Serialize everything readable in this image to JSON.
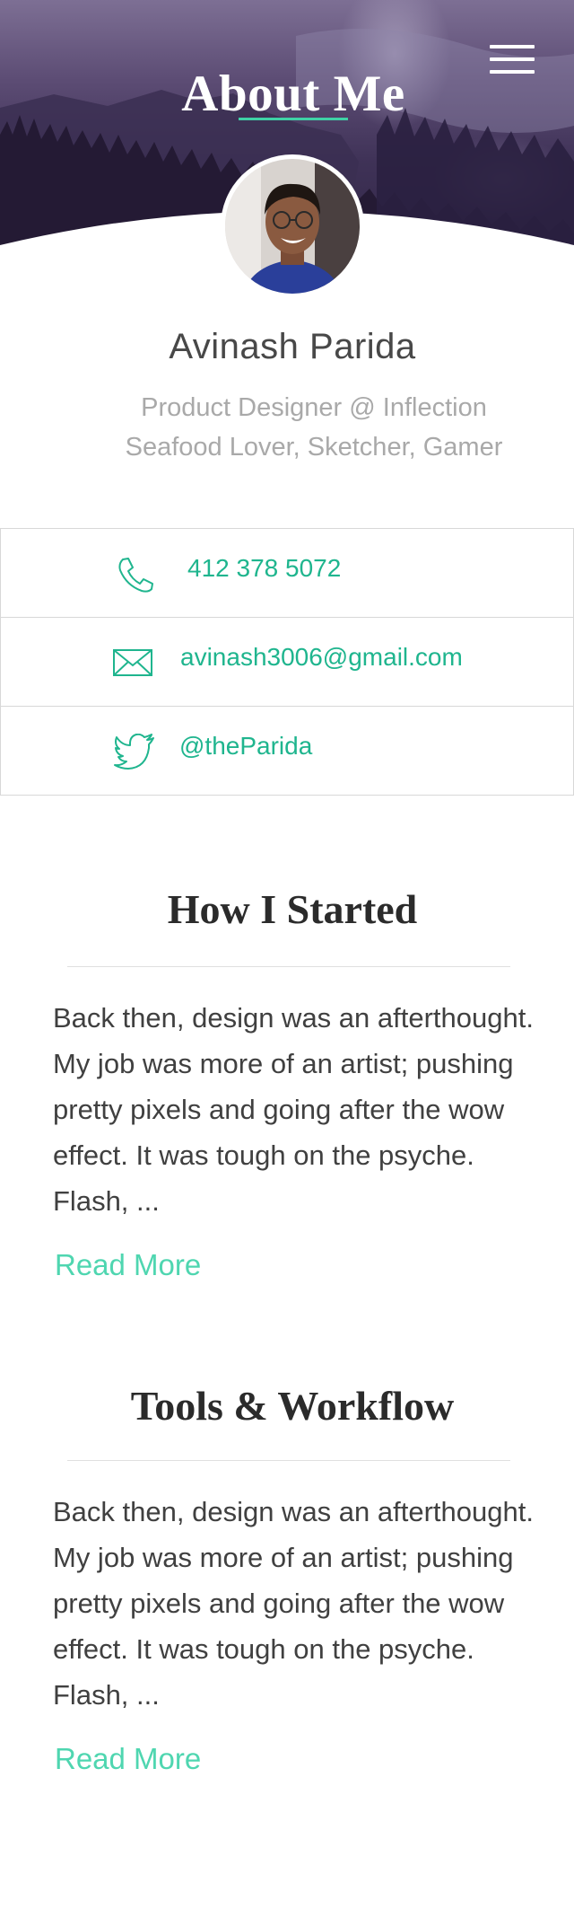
{
  "header": {
    "title": "About Me",
    "menu_icon": "hamburger-menu-icon",
    "accent_color": "#3fd1a6"
  },
  "profile": {
    "avatar_icon": "profile-photo",
    "name": "Avinash Parida",
    "bio_line_1": "Product Designer @ Inflection",
    "bio_line_2": "Seafood Lover, Sketcher, Gamer"
  },
  "contacts": [
    {
      "icon": "phone-icon",
      "label": "412 378 5072"
    },
    {
      "icon": "mail-icon",
      "label": "avinash3006@gmail.com"
    },
    {
      "icon": "twitter-icon",
      "label": "@theParida"
    }
  ],
  "articles": [
    {
      "title": "How I Started",
      "excerpt": "Back then, design was an afterthought. My job was more of an artist; pushing pretty pixels and going after the wow effect. It was tough on the psyche. Flash, ...",
      "link_label": "Read More"
    },
    {
      "title": "Tools & Workflow",
      "excerpt": "Back then, design was an afterthought. My job was more of an artist; pushing pretty pixels and going after the wow effect. It was tough on the psyche. Flash, ...",
      "link_label": "Read More"
    }
  ],
  "colors": {
    "link": "#1fb58e",
    "read_more": "#4fd6b0",
    "muted_text": "#a9a9a9"
  }
}
